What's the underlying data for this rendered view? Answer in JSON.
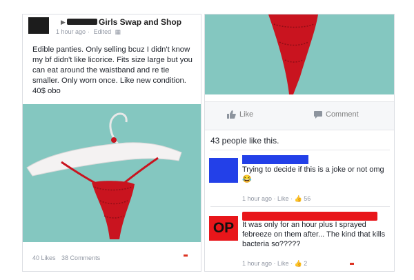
{
  "post": {
    "group_name": "Girls Swap and Shop",
    "time": "1 hour ago",
    "edited": "Edited",
    "body": "Edible panties. Only selling bcuz I didn't know my bf didn't like licorice. Fits size large but you can eat around the waistband and re tie smaller. Only worn once. Like new condition. 40$ obo",
    "likes_count": "40 Likes",
    "comments_count": "38 Comments"
  },
  "actions": {
    "like_label": "Like",
    "comment_label": "Comment"
  },
  "likes_summary": "43 people like this.",
  "comments": [
    {
      "text": "Trying to decide if this is a joke or not omg 😂",
      "time": "1 hour ago",
      "like_label": "Like",
      "like_count": "56"
    },
    {
      "avatar_text": "OP",
      "text": "It was only for an hour plus I sprayed febreeze on them after... The kind that kills bacteria so?????",
      "time": "1 hour ago",
      "like_label": "Like",
      "like_count": "2"
    }
  ],
  "colors": {
    "photo_bg": "#84c7c0",
    "licorice": "#c9141f",
    "redaction_blue": "#2340e8",
    "redaction_red": "#e8161a"
  },
  "icons": [
    "thumbs-up-icon",
    "comment-bubble-icon",
    "privacy-icon"
  ]
}
